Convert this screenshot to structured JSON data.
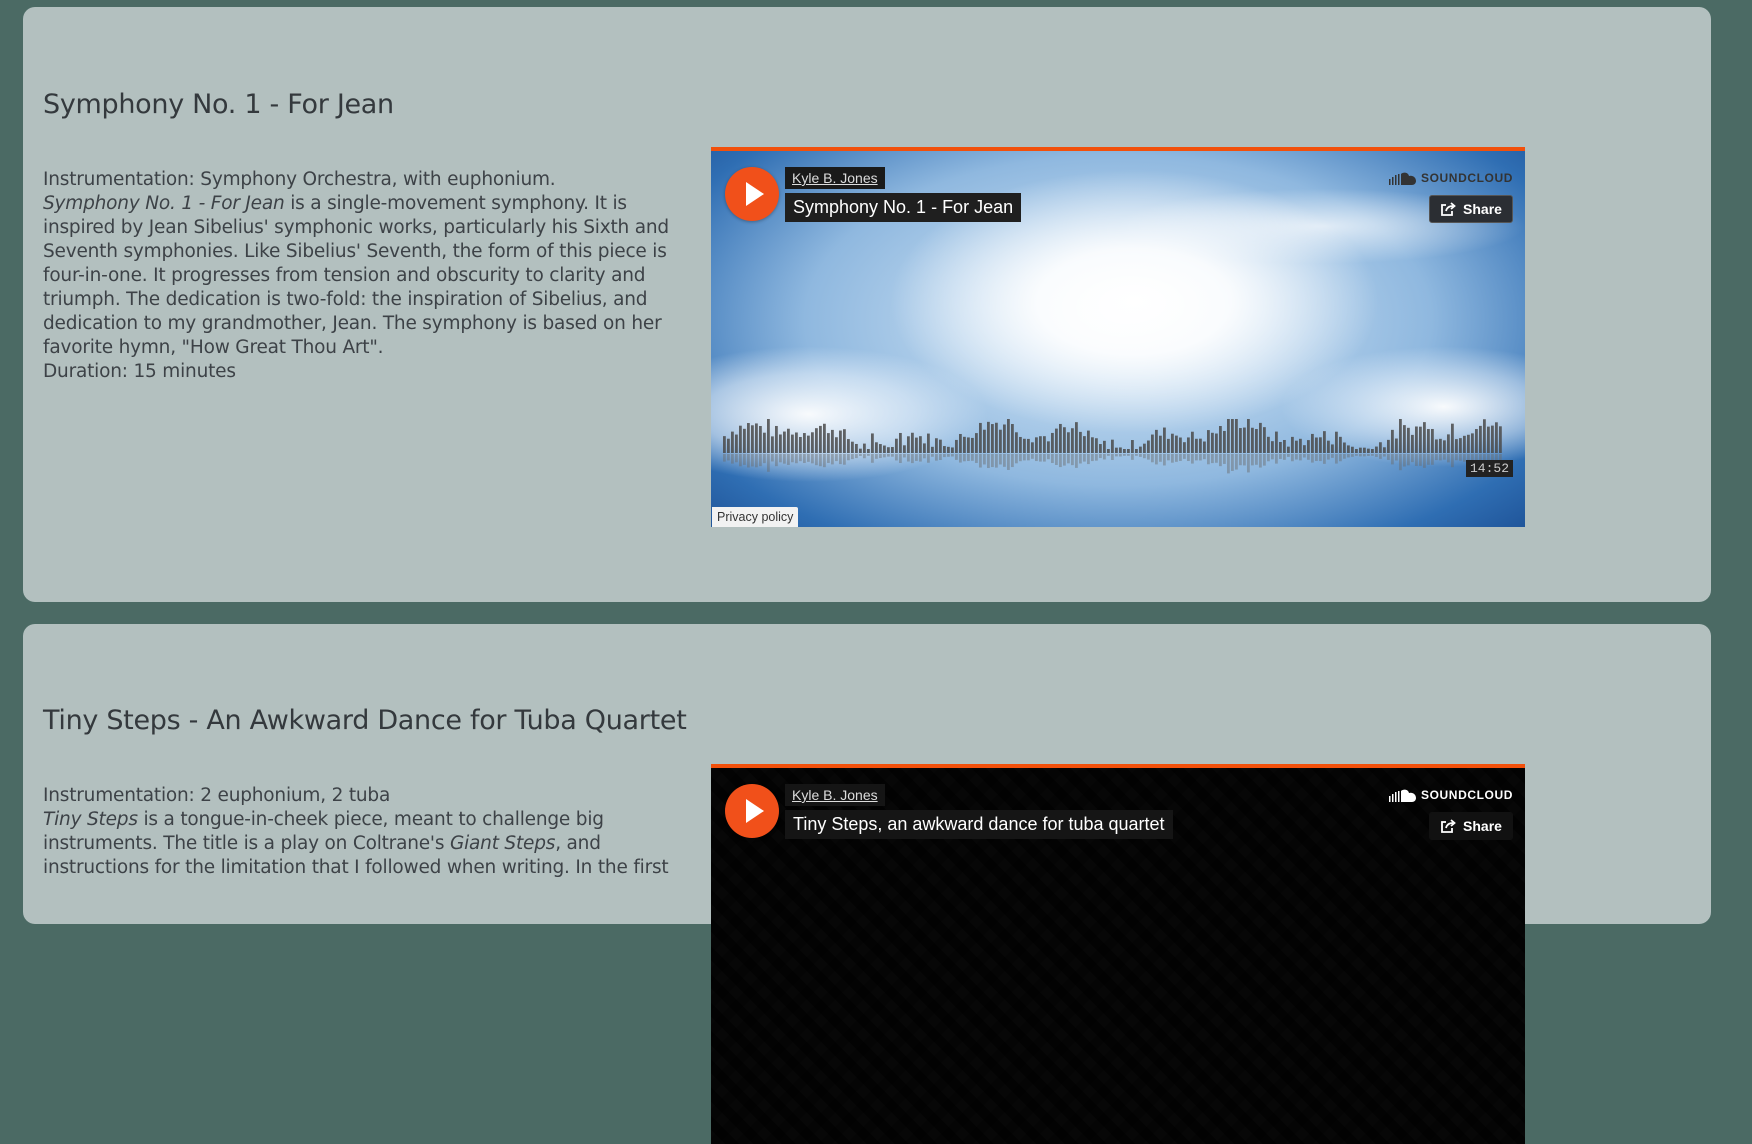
{
  "pieces": [
    {
      "title": "Symphony No. 1 - For Jean",
      "instrumentation": "Instrumentation: Symphony Orchestra, with euphonium.",
      "desc_title_italic": "Symphony No. 1 - For Jean",
      "desc_body": " is a single-movement symphony. It is inspired by Jean Sibelius' symphonic works, particularly his Sixth and Seventh symphonies. Like Sibelius' Seventh, the form of this piece is four-in-one. It progresses from tension and obscurity to clarity and triumph. The dedication is two-fold: the inspiration of Sibelius, and dedication to my grandmother, Jean. The symphony is based on her favorite hymn, \"How Great Thou Art\".",
      "duration": "Duration: 15 minutes",
      "player": {
        "artist": "Kyle B. Jones",
        "track": "Symphony No. 1 - For Jean",
        "brand": "SOUNDCLOUD",
        "share_label": "Share",
        "time": "14:52",
        "privacy_label": "Privacy policy",
        "icon": "play-icon",
        "accent": "#f2500b"
      }
    },
    {
      "title": "Tiny Steps - An Awkward Dance for Tuba Quartet",
      "instrumentation": "Instrumentation: 2 euphonium, 2 tuba",
      "desc_title_italic": "Tiny Steps",
      "desc_mid": " is a tongue-in-cheek piece, meant to challenge big instruments. The title is a play on Coltrane's ",
      "desc_italic2": "Giant Steps",
      "desc_body": ", and instructions for the limitation that I followed when writing. In the first",
      "player": {
        "artist": "Kyle B. Jones",
        "track": "Tiny Steps, an awkward dance for tuba quartet",
        "brand": "SOUNDCLOUD",
        "share_label": "Share",
        "icon": "play-icon"
      }
    }
  ]
}
